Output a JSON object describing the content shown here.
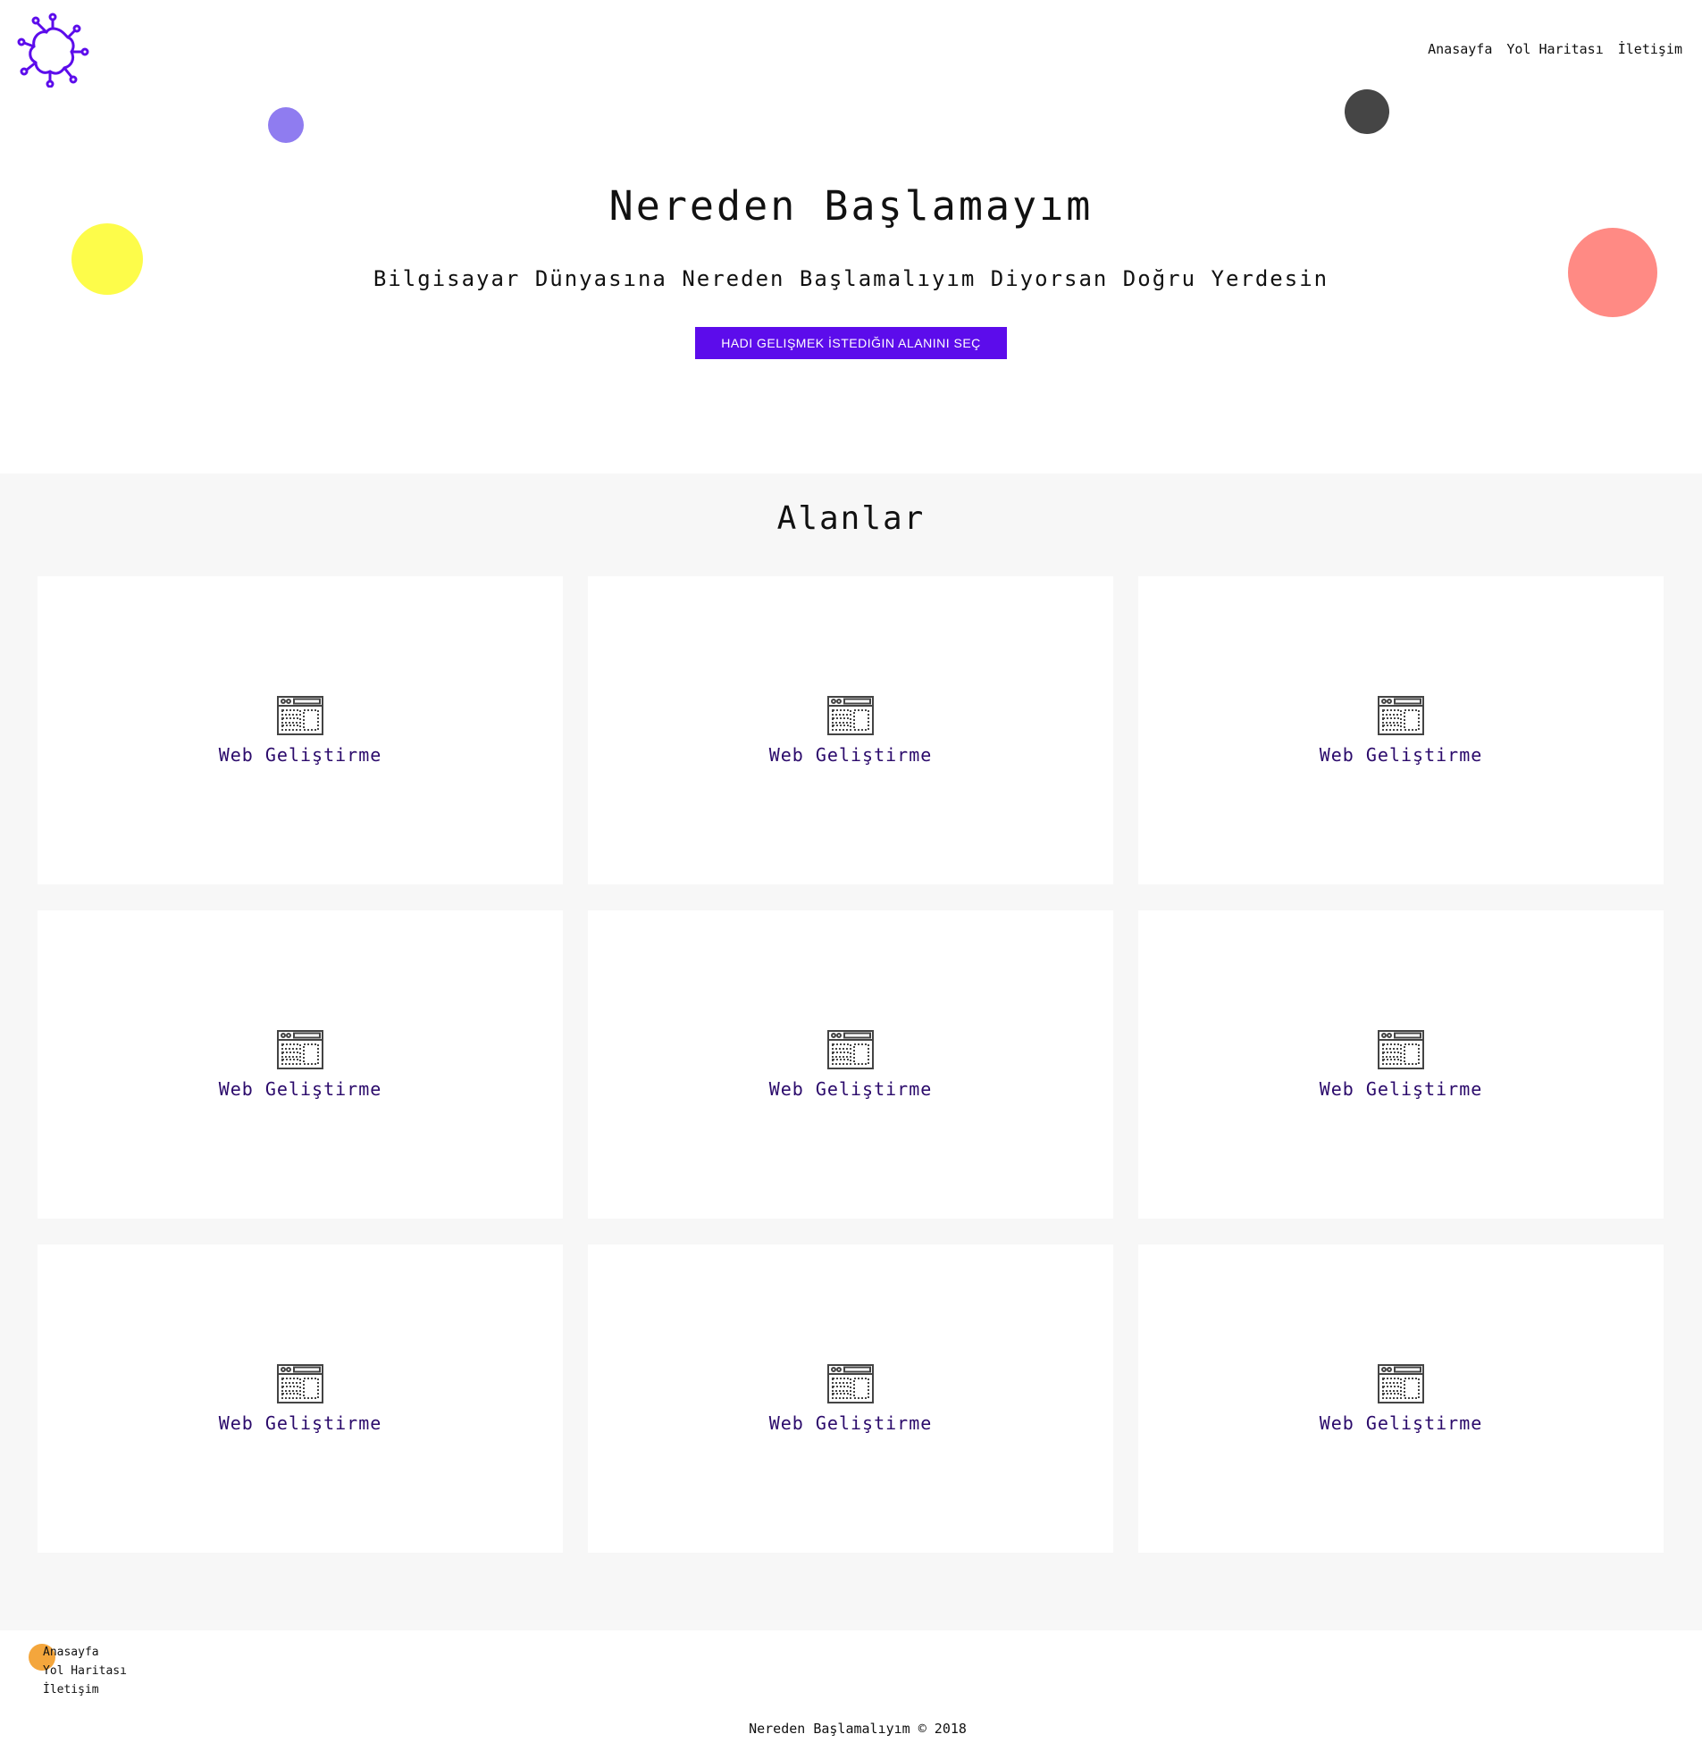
{
  "header": {
    "logo_icon": "molecule-logo-icon",
    "brand_color": "#5c0ceb",
    "nav": [
      {
        "label": "Anasayfa"
      },
      {
        "label": "Yol Haritası"
      },
      {
        "label": "İletişim"
      }
    ]
  },
  "hero": {
    "title": "Nereden Başlamayım",
    "subtitle": "Bilgisayar Dünyasına Nereden Başlamalıyım Diyorsan Doğru Yerdesin",
    "cta_label": "HADI GELIŞMEK İSTEDIĞIN ALANINI SEÇ"
  },
  "section": {
    "title": "Alanlar",
    "cards": [
      {
        "label": "Web Geliştirme",
        "icon": "browser-window-icon"
      },
      {
        "label": "Web Geliştirme",
        "icon": "browser-window-icon"
      },
      {
        "label": "Web Geliştirme",
        "icon": "browser-window-icon"
      },
      {
        "label": "Web Geliştirme",
        "icon": "browser-window-icon"
      },
      {
        "label": "Web Geliştirme",
        "icon": "browser-window-icon"
      },
      {
        "label": "Web Geliştirme",
        "icon": "browser-window-icon"
      },
      {
        "label": "Web Geliştirme",
        "icon": "browser-window-icon"
      },
      {
        "label": "Web Geliştirme",
        "icon": "browser-window-icon"
      },
      {
        "label": "Web Geliştirme",
        "icon": "browser-window-icon"
      }
    ]
  },
  "footer": {
    "nav": [
      {
        "label": "Anasayfa"
      },
      {
        "label": "Yol Haritası"
      },
      {
        "label": "İletişim"
      }
    ],
    "copyright": "Nereden Başlamalıyım © 2018"
  },
  "colors": {
    "accent": "#5c0ceb",
    "section_bg": "#f7f7f7",
    "card_label": "#2b0a6b",
    "circle_purple": "#8f7cf0",
    "circle_yellow": "#fdfc4a",
    "circle_dark": "#454545",
    "circle_pink": "#ff8a84",
    "circle_orange": "#f4a63c"
  }
}
